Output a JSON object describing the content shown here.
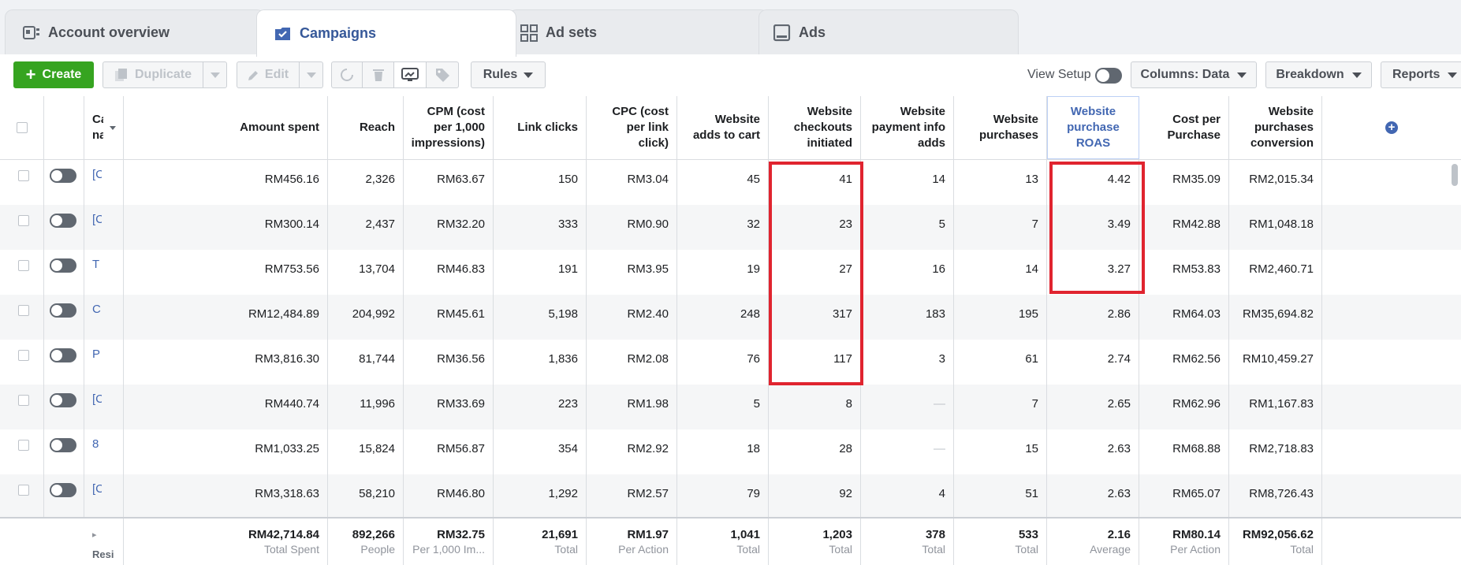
{
  "tabs": [
    {
      "label": "Account overview",
      "icon": "account-overview-icon"
    },
    {
      "label": "Campaigns",
      "icon": "campaign-checkbox-icon"
    },
    {
      "label": "Ad sets",
      "icon": "grid-icon"
    },
    {
      "label": "Ads",
      "icon": "ad-icon"
    }
  ],
  "toolbar": {
    "create": "Create",
    "duplicate": "Duplicate",
    "edit": "Edit",
    "rules": "Rules",
    "view_setup": "View Setup",
    "columns": "Columns: Data",
    "breakdown": "Breakdown",
    "reports": "Reports"
  },
  "columns": {
    "name": "Ca na",
    "amount_spent": "Amount spent",
    "reach": "Reach",
    "cpm": "CPM (cost per 1,000 impressions)",
    "link_clicks": "Link clicks",
    "cpc": "CPC (cost per link click)",
    "adds_to_cart": "Website adds to cart",
    "checkouts": "Website checkouts initiated",
    "payment_info": "Website payment info adds",
    "purchases": "Website purchases",
    "roas": "Website purchase ROAS",
    "cost_per_purchase": "Cost per Purchase",
    "conversion": "Website purchases conversion"
  },
  "rows": [
    {
      "name": "[C",
      "amount": "RM456.16",
      "reach": "2,326",
      "cpm": "RM63.67",
      "clicks": "150",
      "cpc": "RM3.04",
      "cart": "45",
      "checkouts": "41",
      "payment": "14",
      "purchases": "13",
      "roas": "4.42",
      "cpp": "RM35.09",
      "conv": "RM2,015.34"
    },
    {
      "name": "[C",
      "amount": "RM300.14",
      "reach": "2,437",
      "cpm": "RM32.20",
      "clicks": "333",
      "cpc": "RM0.90",
      "cart": "32",
      "checkouts": "23",
      "payment": "5",
      "purchases": "7",
      "roas": "3.49",
      "cpp": "RM42.88",
      "conv": "RM1,048.18"
    },
    {
      "name": "T",
      "amount": "RM753.56",
      "reach": "13,704",
      "cpm": "RM46.83",
      "clicks": "191",
      "cpc": "RM3.95",
      "cart": "19",
      "checkouts": "27",
      "payment": "16",
      "purchases": "14",
      "roas": "3.27",
      "cpp": "RM53.83",
      "conv": "RM2,460.71"
    },
    {
      "name": "C",
      "amount": "RM12,484.89",
      "reach": "204,992",
      "cpm": "RM45.61",
      "clicks": "5,198",
      "cpc": "RM2.40",
      "cart": "248",
      "checkouts": "317",
      "payment": "183",
      "purchases": "195",
      "roas": "2.86",
      "cpp": "RM64.03",
      "conv": "RM35,694.82"
    },
    {
      "name": "P",
      "amount": "RM3,816.30",
      "reach": "81,744",
      "cpm": "RM36.56",
      "clicks": "1,836",
      "cpc": "RM2.08",
      "cart": "76",
      "checkouts": "117",
      "payment": "3",
      "purchases": "61",
      "roas": "2.74",
      "cpp": "RM62.56",
      "conv": "RM10,459.27"
    },
    {
      "name": "[C",
      "amount": "RM440.74",
      "reach": "11,996",
      "cpm": "RM33.69",
      "clicks": "223",
      "cpc": "RM1.98",
      "cart": "5",
      "checkouts": "8",
      "payment": "—",
      "purchases": "7",
      "roas": "2.65",
      "cpp": "RM62.96",
      "conv": "RM1,167.83"
    },
    {
      "name": "8",
      "amount": "RM1,033.25",
      "reach": "15,824",
      "cpm": "RM56.87",
      "clicks": "354",
      "cpc": "RM2.92",
      "cart": "18",
      "checkouts": "28",
      "payment": "—",
      "purchases": "15",
      "roas": "2.63",
      "cpp": "RM68.88",
      "conv": "RM2,718.83"
    },
    {
      "name": "[C",
      "amount": "RM3,318.63",
      "reach": "58,210",
      "cpm": "RM46.80",
      "clicks": "1,292",
      "cpc": "RM2.57",
      "cart": "79",
      "checkouts": "92",
      "payment": "4",
      "purchases": "51",
      "roas": "2.63",
      "cpp": "RM65.07",
      "conv": "RM8,726.43"
    }
  ],
  "footer": {
    "results_label": "Resi",
    "amount": {
      "value": "RM42,714.84",
      "label": "Total Spent"
    },
    "reach": {
      "value": "892,266",
      "label": "People"
    },
    "cpm": {
      "value": "RM32.75",
      "label": "Per 1,000 Im..."
    },
    "clicks": {
      "value": "21,691",
      "label": "Total"
    },
    "cpc": {
      "value": "RM1.97",
      "label": "Per Action"
    },
    "cart": {
      "value": "1,041",
      "label": "Total"
    },
    "checkouts": {
      "value": "1,203",
      "label": "Total"
    },
    "payment": {
      "value": "378",
      "label": "Total"
    },
    "purchases": {
      "value": "533",
      "label": "Total"
    },
    "roas": {
      "value": "2.16",
      "label": "Average"
    },
    "cpp": {
      "value": "RM80.14",
      "label": "Per Action"
    },
    "conv": {
      "value": "RM92,056.62",
      "label": "Total"
    }
  },
  "colors": {
    "accent": "#4267b2",
    "create": "#36a420",
    "highlight": "#e0242f"
  }
}
